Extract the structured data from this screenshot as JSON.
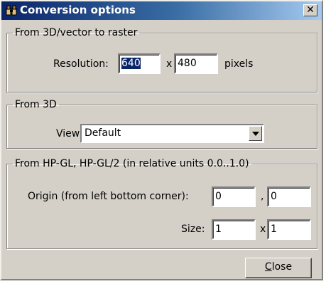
{
  "window": {
    "title": "Conversion options",
    "icon": "binoculars-icon",
    "close_glyph": "✕"
  },
  "raster": {
    "legend": "From 3D/vector to raster",
    "resolution_label": "Resolution:",
    "width_value": "640",
    "x_sep": "x",
    "height_value": "480",
    "units": "pixels"
  },
  "from3d": {
    "legend": "From 3D",
    "view_label": "View:",
    "view_value": "Default"
  },
  "hpgl": {
    "legend": "From HP-GL, HP-GL/2 (in relative units 0.0..1.0)",
    "origin_label": "Origin (from left bottom corner):",
    "origin_x": "0",
    "origin_sep": ",",
    "origin_y": "0",
    "size_label": "Size:",
    "size_w": "1",
    "size_sep": "x",
    "size_h": "1"
  },
  "footer": {
    "close_label_first": "C",
    "close_label_rest": "lose"
  }
}
